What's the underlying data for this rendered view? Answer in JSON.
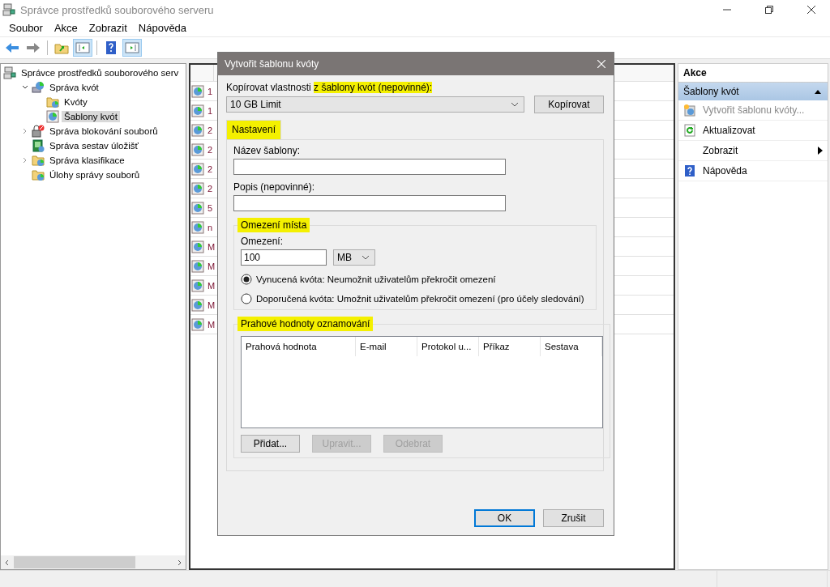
{
  "window": {
    "title": "Správce prostředků souborového serveru"
  },
  "menu": [
    "Soubor",
    "Akce",
    "Zobrazit",
    "Nápověda"
  ],
  "tree": [
    {
      "label": "Správce prostředků souborového serv",
      "kind": "server",
      "selected": false,
      "children": [
        {
          "label": "Správa kvót",
          "kind": "quota",
          "expanded": true,
          "selected": false,
          "children": [
            {
              "label": "Kvóty",
              "kind": "folder",
              "selected": false
            },
            {
              "label": "Šablony kvót",
              "kind": "template",
              "selected": true
            }
          ]
        },
        {
          "label": "Správa blokování souborů",
          "kind": "block",
          "expanded": false,
          "selected": false
        },
        {
          "label": "Správa sestav úložišť",
          "kind": "report",
          "selected": false
        },
        {
          "label": "Správa klasifikace",
          "kind": "folder",
          "expanded": false,
          "selected": false
        },
        {
          "label": "Úlohy správy souborů",
          "kind": "folder",
          "selected": false
        }
      ]
    }
  ],
  "list": {
    "rows": [
      "1",
      "1",
      "2",
      "2",
      "2",
      "2",
      "5",
      "n",
      "M",
      "M",
      "M",
      "M",
      "M"
    ]
  },
  "dialog": {
    "title": "Vytvořit šablonu kvóty",
    "copy_label": [
      {
        "text": "Kopírovat vlastnosti ",
        "highlighted": false
      },
      {
        "text": "z šablony kvót (nepovinné):",
        "highlighted": true
      }
    ],
    "copy_source": "10 GB Limit",
    "copy_button": "Kopírovat",
    "tab": {
      "label": "Nastavení",
      "highlighted": true,
      "selected": true
    },
    "name_label": "Název šablony:",
    "description_label": "Popis (nepovinné):",
    "space_group": {
      "title": "Omezení místa",
      "highlighted": true,
      "limit_label": "Omezení:",
      "limit_value": "100",
      "unit": "MB",
      "options": [
        {
          "label": "Vynucená kvóta: Neumožnit uživatelům překročit omezení",
          "selected": true
        },
        {
          "label": "Doporučená kvóta: Umožnit uživatelům překročit omezení (pro účely sledování)",
          "selected": false
        }
      ]
    },
    "threshold_group": {
      "title": "Prahové hodnoty oznamování",
      "highlighted": true,
      "columns": [
        "Prahová hodnota",
        "E-mail",
        "Protokol u...",
        "Příkaz",
        "Sestava"
      ],
      "buttons": [
        {
          "label": "Přidat...",
          "disabled": false
        },
        {
          "label": "Upravit...",
          "disabled": true
        },
        {
          "label": "Odebrat",
          "disabled": true
        }
      ]
    },
    "ok": "OK",
    "cancel": "Zrušit"
  },
  "actions": {
    "title": "Akce",
    "section": "Šablony kvót",
    "items": [
      {
        "label": "Vytvořit šablonu kvóty...",
        "kind": "new",
        "disabled": true,
        "submenu": false
      },
      {
        "label": "Aktualizovat",
        "kind": "refresh",
        "disabled": false,
        "submenu": false
      },
      {
        "label": "Zobrazit",
        "kind": "plain",
        "disabled": false,
        "submenu": true
      },
      {
        "label": "Nápověda",
        "kind": "help",
        "disabled": false,
        "submenu": false
      }
    ]
  }
}
